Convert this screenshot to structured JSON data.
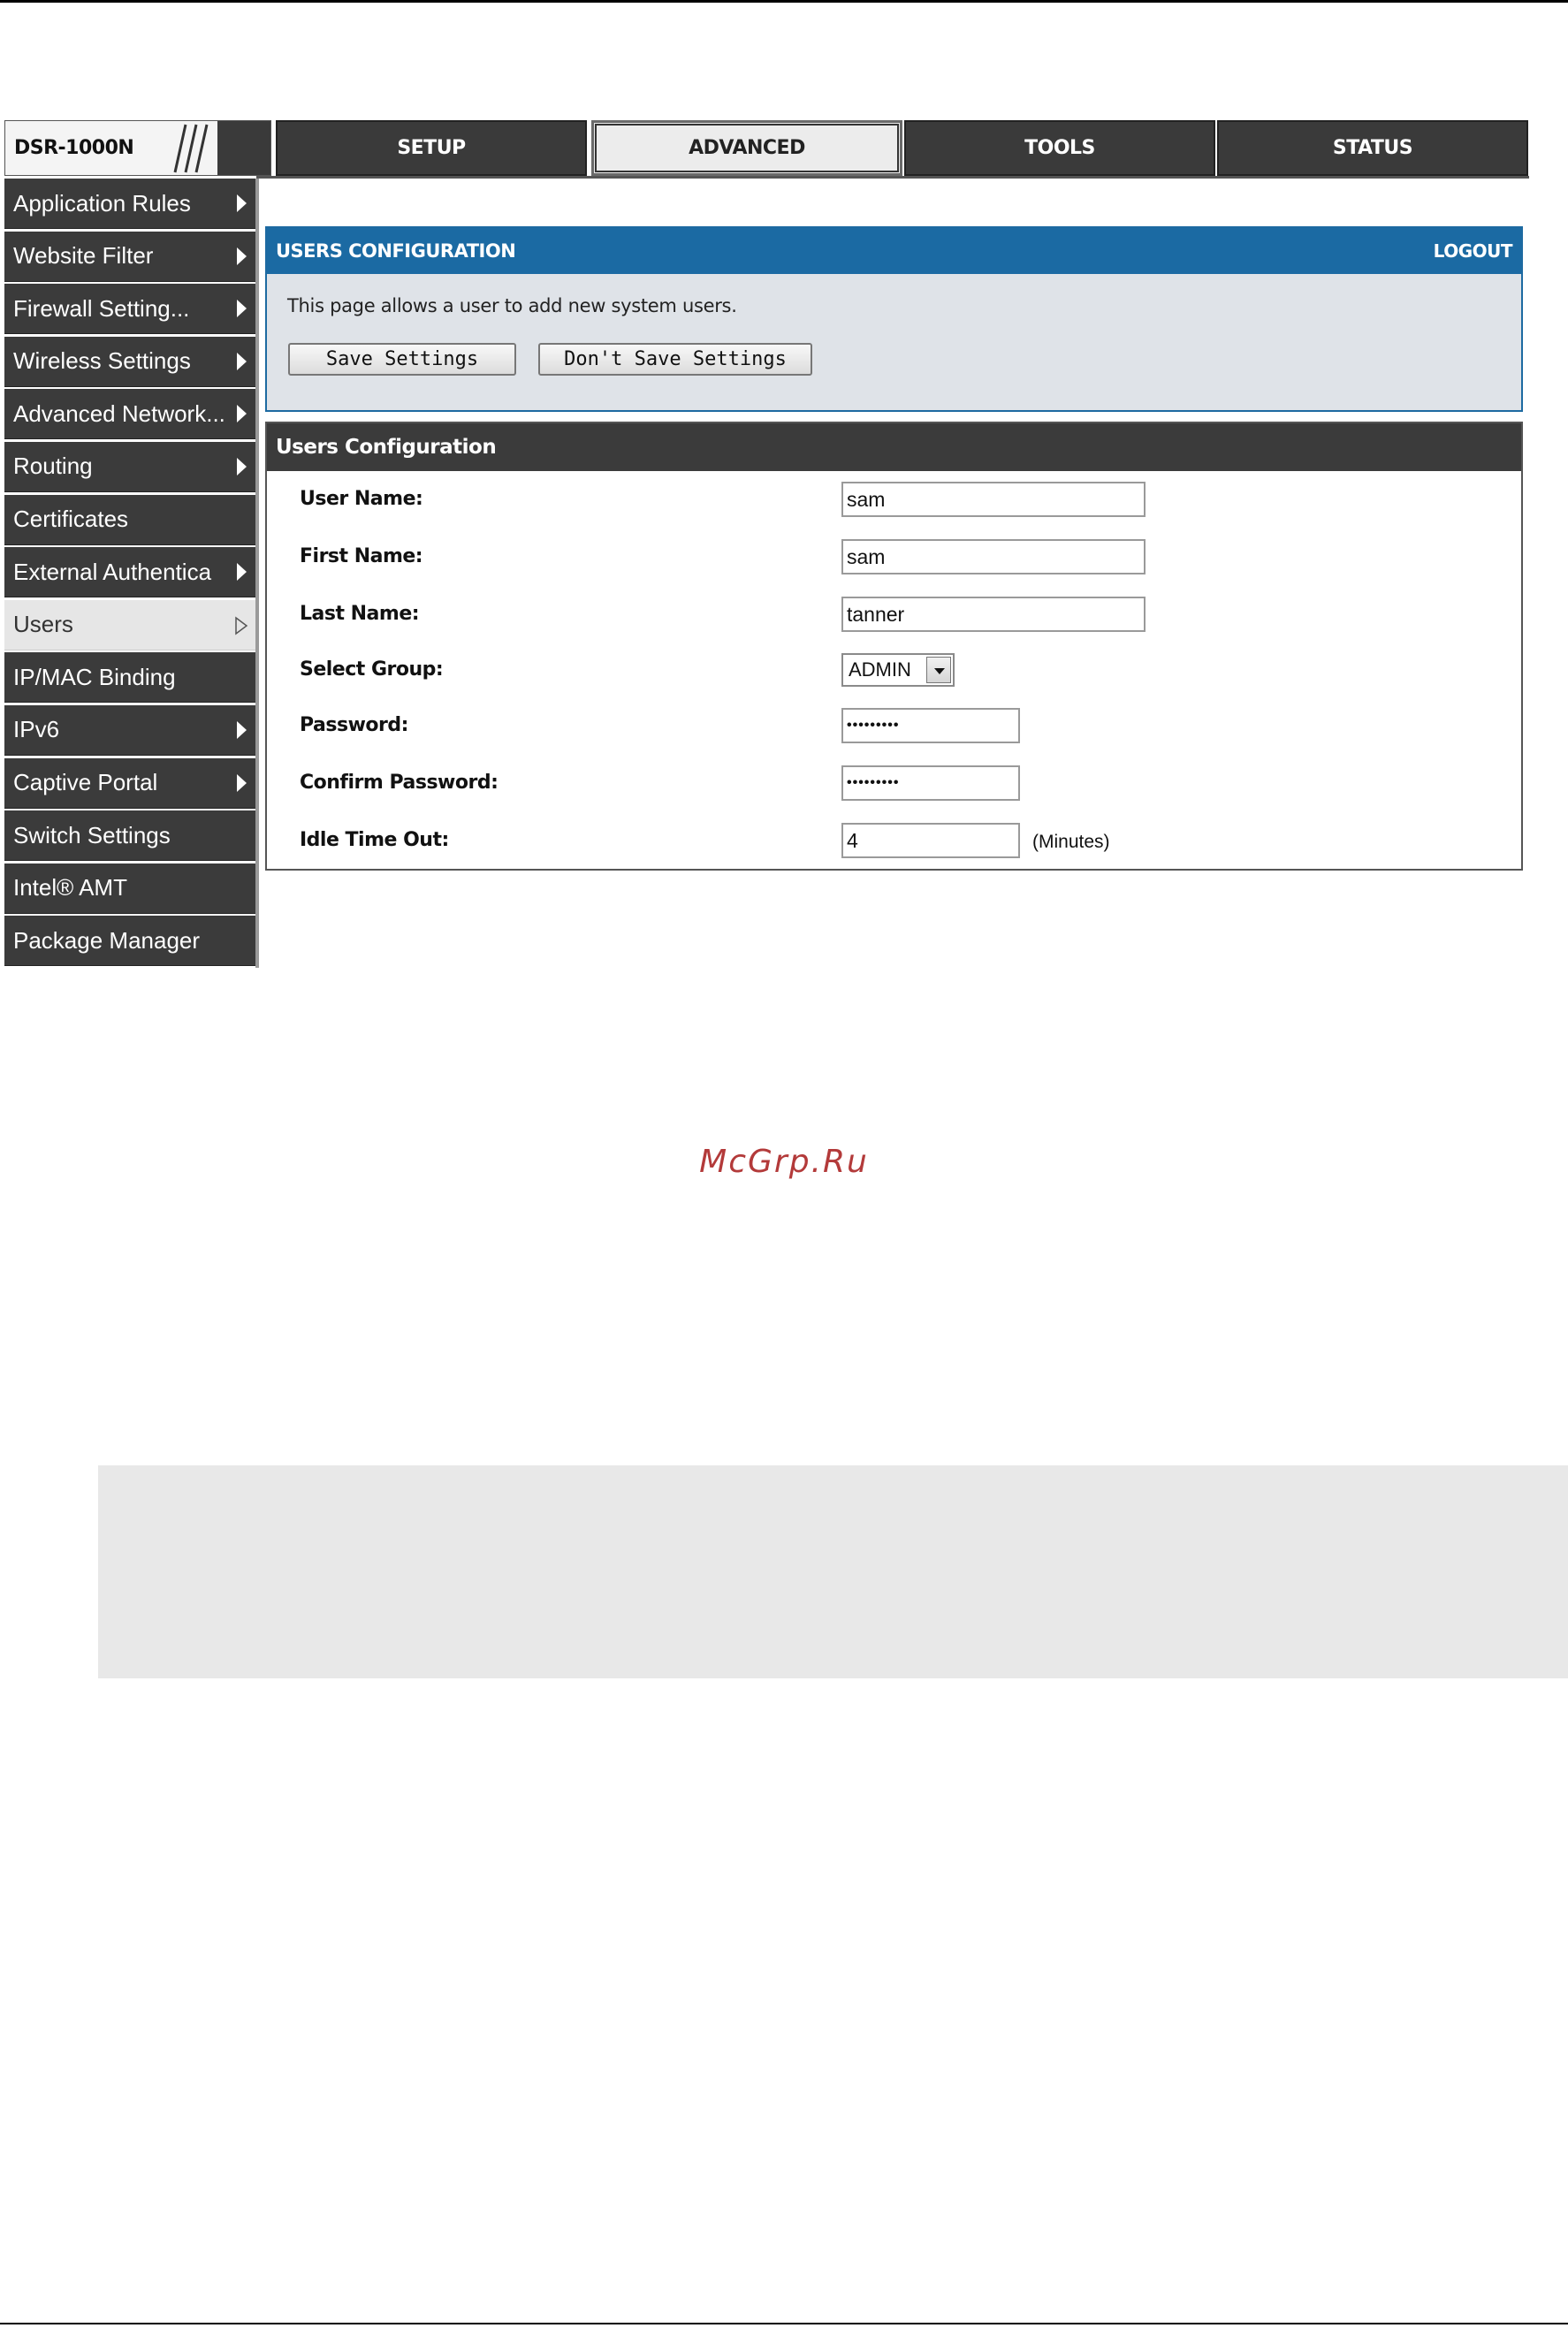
{
  "brand": {
    "model": "DSR-1000N"
  },
  "nav": {
    "tabs": [
      {
        "label": "SETUP"
      },
      {
        "label": "ADVANCED"
      },
      {
        "label": "TOOLS"
      },
      {
        "label": "STATUS"
      }
    ],
    "active_tab": "ADVANCED"
  },
  "sidebar": {
    "items": [
      {
        "label": "Application Rules",
        "arrow": true
      },
      {
        "label": "Website Filter",
        "arrow": true
      },
      {
        "label": "Firewall Setting...",
        "arrow": true
      },
      {
        "label": "Wireless Settings",
        "arrow": true
      },
      {
        "label": "Advanced Network...",
        "arrow": true
      },
      {
        "label": "Routing",
        "arrow": true
      },
      {
        "label": "Certificates",
        "arrow": false
      },
      {
        "label": "External Authentica",
        "arrow": true
      },
      {
        "label": "Users",
        "arrow": true,
        "active": true
      },
      {
        "label": "IP/MAC Binding",
        "arrow": false
      },
      {
        "label": "IPv6",
        "arrow": true
      },
      {
        "label": "Captive Portal",
        "arrow": true
      },
      {
        "label": "Switch Settings",
        "arrow": false
      },
      {
        "label": "Intel® AMT",
        "arrow": false
      },
      {
        "label": "Package Manager",
        "arrow": false
      }
    ]
  },
  "header": {
    "title": "USERS CONFIGURATION",
    "logout_label": "LOGOUT",
    "description": "This page allows a user to add new system users.",
    "save_label": "Save Settings",
    "dont_save_label": "Don't Save Settings"
  },
  "form": {
    "title": "Users Configuration",
    "user_name": {
      "label": "User Name:",
      "value": "sam"
    },
    "first_name": {
      "label": "First Name:",
      "value": "sam"
    },
    "last_name": {
      "label": "Last Name:",
      "value": "tanner"
    },
    "select_group": {
      "label": "Select Group:",
      "value": "ADMIN"
    },
    "password": {
      "label": "Password:",
      "value": "•••••••••"
    },
    "confirm_password": {
      "label": "Confirm Password:",
      "value": "•••••••••"
    },
    "idle_timeout": {
      "label": "Idle Time Out:",
      "value": "4",
      "units": "(Minutes)"
    }
  },
  "watermark": "McGrp.Ru",
  "colors": {
    "header_blue": "#1b6aa3",
    "nav_dark": "#3a3a3a",
    "watermark_red": "#b33a3a"
  }
}
